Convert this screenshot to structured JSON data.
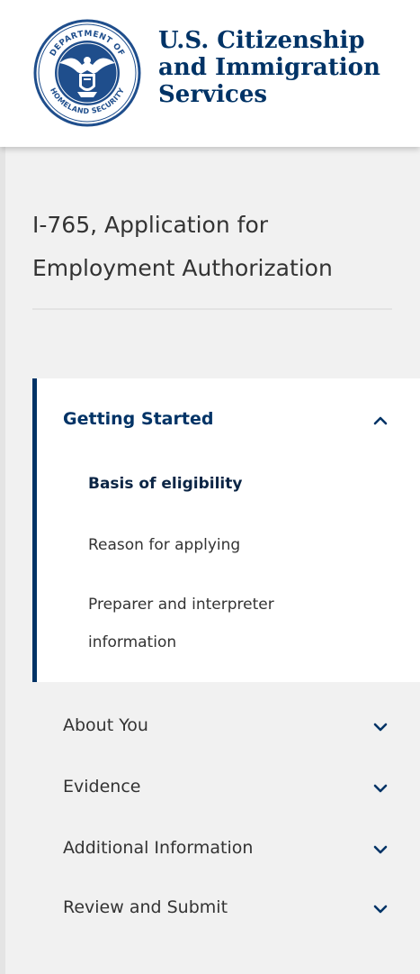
{
  "header": {
    "agency_line1": "U.S. Citizenship",
    "agency_line2": "and Immigration",
    "agency_line3": "Services",
    "seal_icon": "dhs-seal-icon",
    "seal_text_top": "DEPARTMENT OF",
    "seal_text_bottom": "HOMELAND SECURITY"
  },
  "form": {
    "title_line1": "I-765, Application for",
    "title_line2": "Employment Authorization"
  },
  "nav": {
    "active_section": {
      "label": "Getting Started",
      "expanded": true,
      "icon": "chevron-up-icon",
      "items": [
        {
          "label": "Basis of eligibility",
          "current": true
        },
        {
          "label": "Reason for applying",
          "current": false
        },
        {
          "label_line1": "Preparer and interpreter",
          "label_line2": "information",
          "current": false
        }
      ]
    },
    "sections": [
      {
        "label": "About You",
        "icon": "chevron-down-icon"
      },
      {
        "label": "Evidence",
        "icon": "chevron-down-icon"
      },
      {
        "label": "Additional Information",
        "icon": "chevron-down-icon"
      },
      {
        "label": "Review and Submit",
        "icon": "chevron-down-icon"
      }
    ]
  },
  "colors": {
    "brand_navy": "#003366",
    "background": "#f1f1f1",
    "panel": "#ffffff",
    "text": "#333333"
  }
}
